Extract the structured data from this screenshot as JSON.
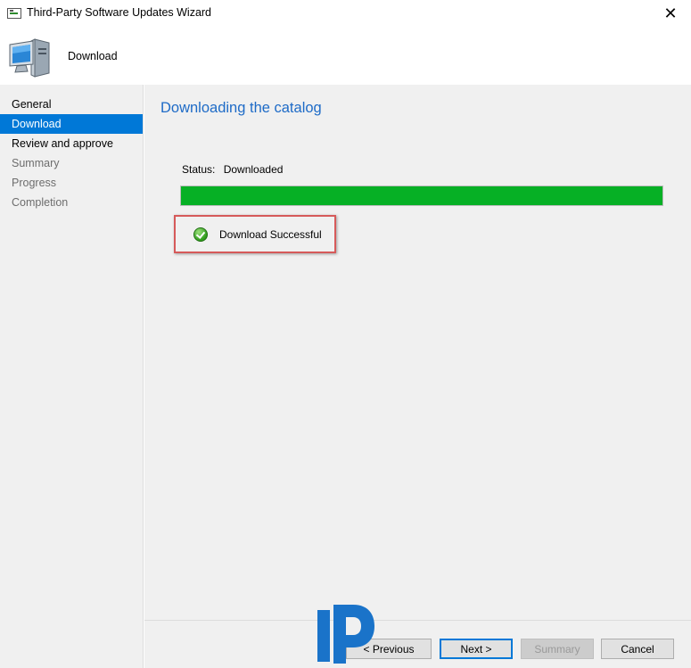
{
  "window": {
    "title": "Third-Party Software Updates Wizard",
    "close_glyph": "✕"
  },
  "header": {
    "title": "Download",
    "icon": "computer-icon"
  },
  "nav": {
    "items": [
      {
        "label": "General",
        "state": "normal"
      },
      {
        "label": "Download",
        "state": "active"
      },
      {
        "label": "Review and approve",
        "state": "normal"
      },
      {
        "label": "Summary",
        "state": "disabled"
      },
      {
        "label": "Progress",
        "state": "disabled"
      },
      {
        "label": "Completion",
        "state": "disabled"
      }
    ]
  },
  "main": {
    "heading": "Downloading the catalog",
    "status_label": "Status:",
    "status_value": "Downloaded",
    "progress_percent": 100,
    "progress_color": "#06b025",
    "result_text": "Download Successful",
    "result_icon": "check-circle-icon"
  },
  "footer": {
    "previous_label": "< Previous",
    "next_label": "Next >",
    "summary_label": "Summary",
    "cancel_label": "Cancel"
  },
  "colors": {
    "accent": "#0078d7",
    "heading": "#1e6bc7",
    "highlight_border": "#d65a5a",
    "watermark": "#1a73c9"
  }
}
